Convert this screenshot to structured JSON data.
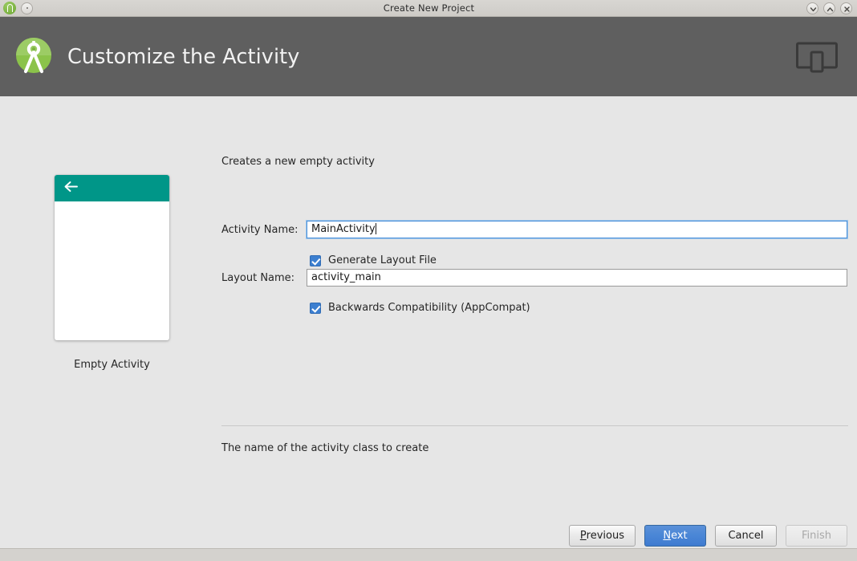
{
  "window": {
    "title": "Create New Project",
    "app_icon": "android-studio-icon",
    "menu_button": "window-menu-icon",
    "controls": [
      {
        "name": "minimize-button",
        "icon": "chevron-down-icon",
        "glyph": "∨"
      },
      {
        "name": "maximize-button",
        "icon": "chevron-up-icon",
        "glyph": "∧"
      },
      {
        "name": "close-button",
        "icon": "close-x-icon",
        "glyph": "✕"
      }
    ]
  },
  "header": {
    "title": "Customize the Activity",
    "logo": "android-studio-compass-logo",
    "right_icon": "tablet-phone-device-icon",
    "background_color": "#5f5f5f",
    "title_color": "#f2f2f2"
  },
  "preview": {
    "caption": "Empty Activity",
    "appbar_color": "#009688",
    "appbar_icon": "back-arrow-icon",
    "body_color": "#ffffff"
  },
  "form": {
    "description": "Creates a new empty activity",
    "fields": [
      {
        "label": "Activity Name:",
        "value": "MainActivity",
        "placeholder": "",
        "focused": true
      },
      {
        "label": "Layout Name:",
        "value": "activity_main",
        "placeholder": "",
        "focused": false
      }
    ],
    "checkboxes": [
      {
        "label": "Generate Layout File",
        "checked": true
      },
      {
        "label": "Backwards Compatibility (AppCompat)",
        "checked": true
      }
    ],
    "hint": "The name of the activity class to create",
    "accent_color": "#3c7fd0"
  },
  "buttons": [
    {
      "label": "Previous",
      "mnemonic": "P",
      "pre": "",
      "post": "revious",
      "style": "normal",
      "enabled": true
    },
    {
      "label": "Next",
      "mnemonic": "N",
      "pre": "",
      "post": "ext",
      "style": "default",
      "enabled": true
    },
    {
      "label": "Cancel",
      "mnemonic": "",
      "pre": "Cancel",
      "post": "",
      "style": "normal",
      "enabled": true
    },
    {
      "label": "Finish",
      "mnemonic": "",
      "pre": "Finish",
      "post": "",
      "style": "disabled",
      "enabled": false
    }
  ]
}
